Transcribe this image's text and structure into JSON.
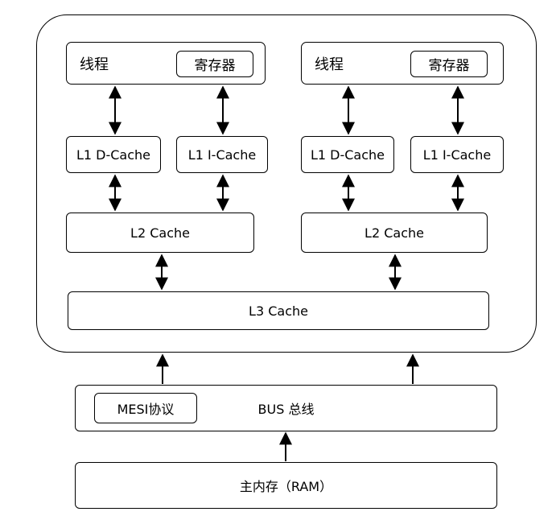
{
  "cpu": {
    "cores": [
      {
        "thread_label": "线程",
        "register_label": "寄存器",
        "l1d_label": "L1 D-Cache",
        "l1i_label": "L1 I-Cache",
        "l2_label": "L2 Cache"
      },
      {
        "thread_label": "线程",
        "register_label": "寄存器",
        "l1d_label": "L1 D-Cache",
        "l1i_label": "L1 I-Cache",
        "l2_label": "L2 Cache"
      }
    ],
    "l3_label": "L3 Cache"
  },
  "bus": {
    "label": "BUS 总线",
    "protocol_label": "MESI协议"
  },
  "memory": {
    "label": "主内存（RAM）"
  }
}
